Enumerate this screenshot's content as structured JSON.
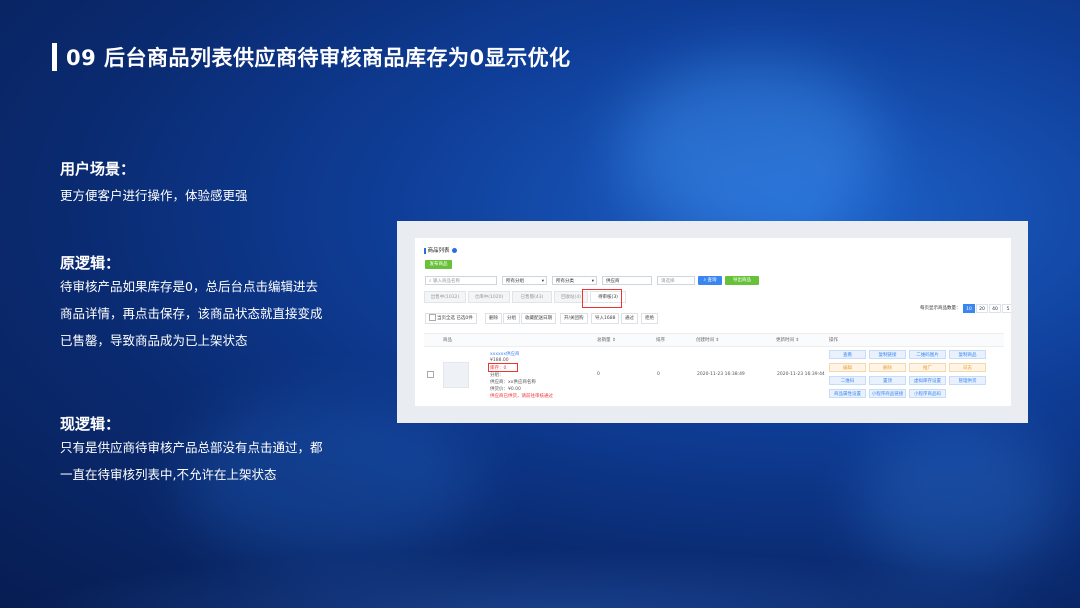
{
  "title": "09 后台商品列表供应商待审核商品库存为0显示优化",
  "sections": [
    {
      "heading": "用户场景：",
      "lines": [
        "更方便客户进行操作，体验感更强"
      ]
    },
    {
      "heading": "原逻辑：",
      "lines": [
        "待审核产品如果库存是0，总后台点击编辑进去",
        "商品详情，再点击保存，该商品状态就直接变成",
        "已售罄，导致商品成为已上架状态"
      ]
    },
    {
      "heading": "现逻辑：",
      "lines": [
        "只有是供应商待审核产品总部没有点击通过，都",
        "一直在待审核列表中,不允许在上架状态"
      ]
    }
  ],
  "screenshot": {
    "page_title": "商品列表",
    "publish_button": "发布商品",
    "search_placeholder": "输入商品名称",
    "filter_category": "所有分组",
    "filter_type": "所有分类",
    "filter_supplier": "供应商",
    "filter_extra": "请选择",
    "search_button": "查询",
    "export_button": "导出商品",
    "tabs": [
      "出售中(1032)",
      "仓库中(1020)",
      "已售罄(43)",
      "回收站(4)",
      "待审核(3)"
    ],
    "active_tab": 4,
    "toolbar": [
      "当页全选  已选0件",
      "删除",
      "分组",
      "收藏配送日期",
      "开/关团购",
      "导入1688",
      "通过",
      "拒绝"
    ],
    "per_page_label": "每页显示商品数量：",
    "per_page_options": [
      "10",
      "20",
      "40",
      "5"
    ],
    "columns": [
      "商品",
      "总销量 ⇕",
      "排序",
      "创建时间 ⇕",
      "更新时间 ⇕",
      "操作"
    ],
    "row": {
      "name": "xxxxxx供应商",
      "price": "¥188.00",
      "stock": "库存：0",
      "group": "分组：",
      "supplier": "供应商：xx供应商名称",
      "cost": "供货价：¥0.00",
      "status": "供应商已供货，请前往审核通过",
      "sales": "0",
      "sort": "0",
      "created": "2020-11-23 16:38:49",
      "updated": "2020-11-23 16:39:44",
      "actions": [
        "查看",
        "复制链接",
        "二维码图片",
        "复制商品",
        "编辑",
        "删除",
        "推广",
        "日志",
        "二维码",
        "置顶",
        "虚拟库存设置",
        "管理供货",
        "商品属性设置",
        "小程序商品链接",
        "小程序商品码"
      ]
    }
  }
}
